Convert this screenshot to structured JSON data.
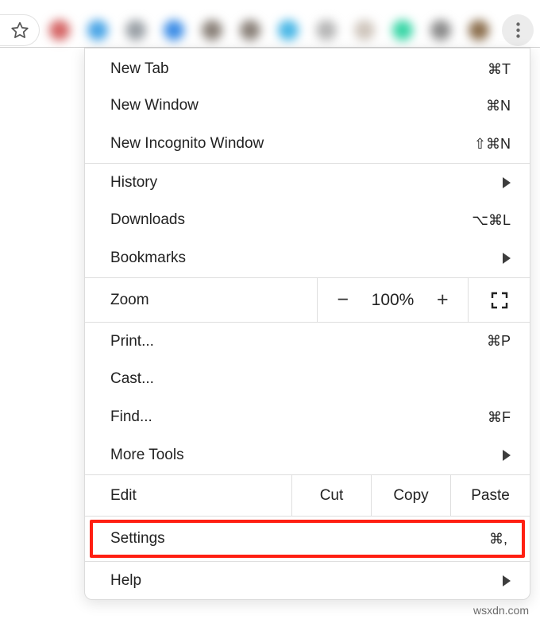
{
  "menu": {
    "new_tab": {
      "label": "New Tab",
      "shortcut": "⌘T"
    },
    "new_window": {
      "label": "New Window",
      "shortcut": "⌘N"
    },
    "incognito": {
      "label": "New Incognito Window",
      "shortcut": "⇧⌘N"
    },
    "history": {
      "label": "History"
    },
    "downloads": {
      "label": "Downloads",
      "shortcut": "⌥⌘L"
    },
    "bookmarks": {
      "label": "Bookmarks"
    },
    "zoom": {
      "label": "Zoom",
      "value": "100%",
      "minus": "−",
      "plus": "+"
    },
    "print": {
      "label": "Print...",
      "shortcut": "⌘P"
    },
    "cast": {
      "label": "Cast..."
    },
    "find": {
      "label": "Find...",
      "shortcut": "⌘F"
    },
    "more_tools": {
      "label": "More Tools"
    },
    "edit": {
      "label": "Edit",
      "cut": "Cut",
      "copy": "Copy",
      "paste": "Paste"
    },
    "settings": {
      "label": "Settings",
      "shortcut": "⌘,"
    },
    "help": {
      "label": "Help"
    }
  },
  "ext_colors": [
    "#d56565",
    "#4aa5e6",
    "#9aa0a6",
    "#3d8de6",
    "#8a8179",
    "#8a8179",
    "#4ab7e6",
    "#b6b6b6",
    "#cfc6bd",
    "#39d6a6",
    "#8b8b8b",
    "#8c6f4e"
  ],
  "watermark": "wsxdn.com"
}
